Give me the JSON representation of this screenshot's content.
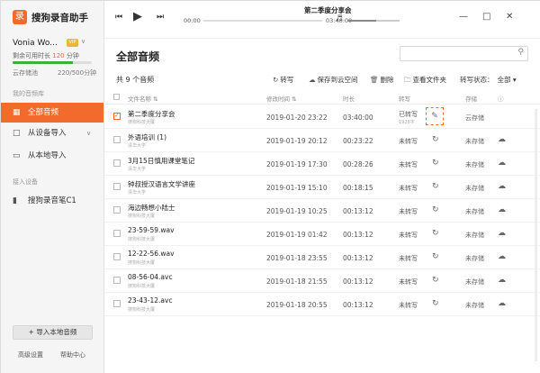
{
  "app": {
    "logo": "录",
    "title": "搜狗录音助手"
  },
  "user": {
    "name": "Vonia Wo...",
    "vip": "VIP",
    "remain_prefix": "剩余可用时长",
    "remain_num": "120",
    "remain_unit": "分钟",
    "usage_fraction": 0.76,
    "cloud_label": "云存储池",
    "cloud_value": "220/500分钟"
  },
  "sidebar": {
    "section_library": "我的音频库",
    "all_audio": "全部音频",
    "import_device": "从设备导入",
    "import_local": "从本地导入",
    "section_device": "接入设备",
    "device": "搜狗录音笔C1",
    "import_button": "+ 导入本地音频",
    "advanced": "高级设置",
    "help": "帮助中心"
  },
  "player": {
    "title": "第二季度分享会",
    "current": "00:00",
    "total": "03:40:00",
    "volume_fraction": 0.55
  },
  "main": {
    "title": "全部音频",
    "count": "共 9 个音频",
    "tools": {
      "transcribe": "转写",
      "save_cloud": "保存到云空间",
      "delete": "删除",
      "show_folder": "查看文件夹"
    },
    "status_label": "转写状态：",
    "status_value": "全部"
  },
  "columns": {
    "name": "文件名称",
    "date": "修改时间",
    "duration": "时长",
    "transcribe": "转写",
    "storage": "存储"
  },
  "rows": [
    {
      "name": "第二季度分享会",
      "sub": "搜狗科技大厦",
      "date": "2019-01-20  23:22",
      "duration": "03:40:00",
      "tr": "已转写",
      "tr_sub": "1928字",
      "storage": "云存储",
      "checked": true
    },
    {
      "name": "外语培训 (1)",
      "sub": "清华大学",
      "date": "2019-01-19  20:12",
      "duration": "00:23:22",
      "tr": "未转写",
      "storage": "未存储"
    },
    {
      "name": "3月15日慎用课堂笔记",
      "sub": "清华大学",
      "date": "2019-01-19  17:30",
      "duration": "00:28:26",
      "tr": "未转写",
      "storage": "未存储"
    },
    {
      "name": "钟叔授汉语言文学讲座",
      "sub": "清华大学",
      "date": "2019-01-19  15:10",
      "duration": "00:18:15",
      "tr": "未转写",
      "storage": "未存储"
    },
    {
      "name": "海边畅想小陆士",
      "sub": "搜狗科技大厦",
      "date": "2019-01-19  10:25",
      "duration": "00:13:12",
      "tr": "未转写",
      "storage": "未存储"
    },
    {
      "name": "23-59-59.wav",
      "sub": "搜狗科技大厦",
      "date": "2019-01-19  01:42",
      "duration": "00:13:12",
      "tr": "未转写",
      "storage": "未存储"
    },
    {
      "name": "12-22-56.wav",
      "sub": "搜狗科技大厦",
      "date": "2019-01-18  23:55",
      "duration": "00:13:12",
      "tr": "未转写",
      "storage": "未存储"
    },
    {
      "name": "08-56-04.avc",
      "sub": "搜狗科技大厦",
      "date": "2019-01-18  21:55",
      "duration": "00:13:12",
      "tr": "未转写",
      "storage": "未存储"
    },
    {
      "name": "23-43-12.avc",
      "sub": "搜狗科技大厦",
      "date": "2019-01-18  20:55",
      "duration": "00:13:12",
      "tr": "未转写",
      "storage": "未存储"
    }
  ]
}
